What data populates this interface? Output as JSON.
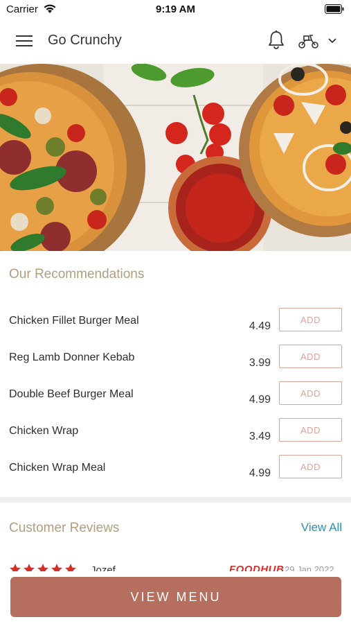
{
  "status_bar": {
    "carrier": "Carrier",
    "time": "9:19 AM"
  },
  "header": {
    "title": "Go Crunchy"
  },
  "recommendations": {
    "title": "Our Recommendations",
    "add_label": "ADD",
    "items": [
      {
        "name": "Chicken Fillet Burger Meal",
        "price": "4.49"
      },
      {
        "name": "Reg Lamb Donner Kebab",
        "price": "3.99"
      },
      {
        "name": "Double Beef Burger Meal",
        "price": "4.99"
      },
      {
        "name": "Chicken Wrap",
        "price": "3.49"
      },
      {
        "name": "Chicken Wrap Meal",
        "price": "4.99"
      }
    ]
  },
  "reviews": {
    "title": "Customer Reviews",
    "view_all": "View All",
    "first": {
      "stars": 5,
      "reviewer": "Jozef",
      "source": "FOODHUB",
      "date": "29 Jan 2022"
    }
  },
  "footer": {
    "view_menu": "VIEW MENU"
  },
  "colors": {
    "accent": "#b66f5e",
    "section_title": "#b19e7f",
    "link": "#2b8fb6",
    "add_border": "#dba39a",
    "star": "#d6302a"
  }
}
